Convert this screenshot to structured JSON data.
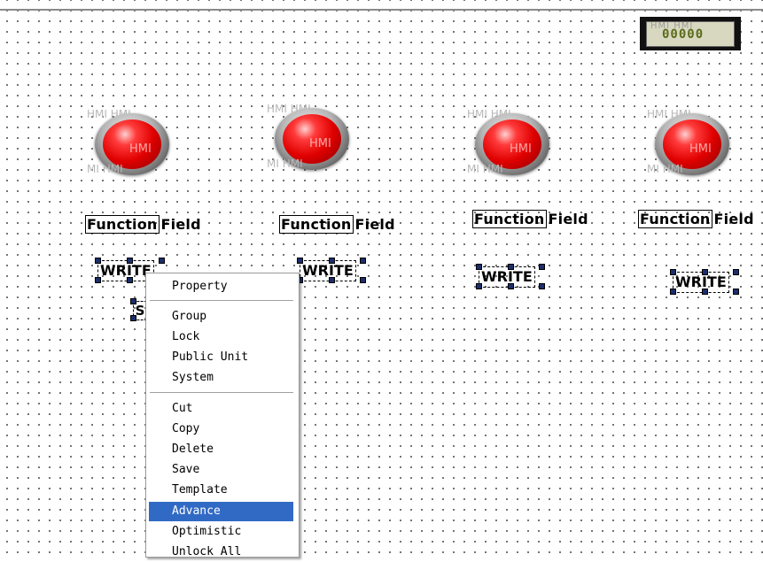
{
  "numeric_display": {
    "ghost_text": "HMI   HMI",
    "value": "00000"
  },
  "lamps": [
    {
      "ghost_top": "HMI   HMI",
      "center": "HMI",
      "ghost_bottom": "MI   HMI"
    },
    {
      "ghost_top": "HMI   HMI",
      "center": "HMI",
      "ghost_bottom": "MI   HMI"
    },
    {
      "ghost_top": "HMI   HMI",
      "center": "HMI",
      "ghost_bottom": "MI   HMI"
    },
    {
      "ghost_top": "HMI   HMI",
      "center": "HMI",
      "ghost_bottom": "MI   HMI"
    }
  ],
  "function_fields": [
    {
      "part_a": "Function",
      "part_b": "Field"
    },
    {
      "part_a": "Function",
      "part_b": "Field"
    },
    {
      "part_a": "Function",
      "part_b": "Field"
    },
    {
      "part_a": "Function",
      "part_b": "Field"
    }
  ],
  "write_buttons": [
    "WRITE",
    "WRITE",
    "WRITE",
    "WRITE"
  ],
  "partial_object_label": "S",
  "context_menu": {
    "items": [
      "Property",
      "Group",
      "Lock",
      "Public Unit",
      "System",
      "Cut",
      "Copy",
      "Delete",
      "Save",
      "Template",
      "Advance",
      "Optimistic",
      "Unlock All"
    ],
    "highlighted": "Advance",
    "highlight_color": "#316ac5"
  },
  "colors": {
    "lamp_red": "#e00000",
    "selection_handle": "#1b2d6b"
  }
}
